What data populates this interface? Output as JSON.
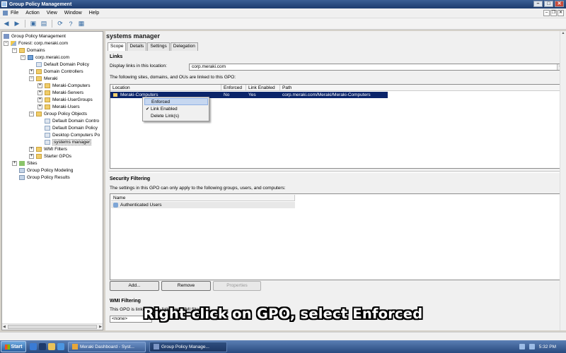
{
  "window": {
    "title": "Group Policy Management"
  },
  "menu": [
    "File",
    "Action",
    "View",
    "Window",
    "Help"
  ],
  "tree": {
    "items": [
      {
        "label": "Group Policy Management",
        "icon": "gpm-icon"
      },
      {
        "label": "Forest: corp.meraki.com",
        "icon": "forest-icon"
      },
      {
        "label": "Domains",
        "icon": "folder-icon"
      },
      {
        "label": "corp.meraki.com",
        "icon": "domain-icon"
      },
      {
        "label": "Default Domain Policy",
        "icon": "gpo-link-icon"
      },
      {
        "label": "Domain Controllers",
        "icon": "ou-icon"
      },
      {
        "label": "Meraki",
        "icon": "ou-icon"
      },
      {
        "label": "Meraki-Computers",
        "icon": "ou-icon"
      },
      {
        "label": "Meraki-Servers",
        "icon": "ou-icon"
      },
      {
        "label": "Meraki-UserGroups",
        "icon": "ou-icon"
      },
      {
        "label": "Meraki-Users",
        "icon": "ou-icon"
      },
      {
        "label": "Group Policy Objects",
        "icon": "folder-icon"
      },
      {
        "label": "Default Domain Contro",
        "icon": "gpo-icon"
      },
      {
        "label": "Default Domain Policy",
        "icon": "gpo-icon"
      },
      {
        "label": "Desktop Computers Po",
        "icon": "gpo-icon"
      },
      {
        "label": "systems manager",
        "icon": "gpo-icon"
      },
      {
        "label": "WMI Filters",
        "icon": "folder-icon"
      },
      {
        "label": "Starter GPOs",
        "icon": "folder-icon"
      },
      {
        "label": "Sites",
        "icon": "sites-icon"
      },
      {
        "label": "Group Policy Modeling",
        "icon": "report-icon"
      },
      {
        "label": "Group Policy Results",
        "icon": "report-icon"
      }
    ]
  },
  "right": {
    "title": "systems manager",
    "tabs": [
      "Scope",
      "Details",
      "Settings",
      "Delegation"
    ],
    "links": {
      "heading": "Links",
      "display_label": "Display links in this location:",
      "location_value": "corp.meraki.com",
      "description": "The following sites, domains, and OUs are linked to this GPO:",
      "columns": [
        "Location",
        "Enforced",
        "Link Enabled",
        "Path"
      ],
      "row": {
        "location": "Meraki-Computers",
        "enforced": "No",
        "link_enabled": "Yes",
        "path": "corp.meraki.com/Meraki/Meraki-Computers"
      }
    },
    "context_menu": {
      "items": [
        "Enforced",
        "Link Enabled",
        "Delete Link(s)"
      ],
      "checked_item": "Link Enabled",
      "hovered_item": "Enforced"
    },
    "security": {
      "heading": "Security Filtering",
      "description": "The settings in this GPO can only apply to the following groups, users, and computers:",
      "column": "Name",
      "entries": [
        "Authenticated Users"
      ]
    },
    "buttons": {
      "add": "Add...",
      "remove": "Remove",
      "properties": "Properties"
    },
    "wmi": {
      "heading": "WMI Filtering",
      "description": "This GPO is linked to the following WMI filter:",
      "value": "<none>"
    }
  },
  "caption": "Right-click on GPO, select Enforced",
  "taskbar": {
    "start_label": "Start",
    "tasks": [
      "Meraki Dashboard - Syst...",
      "Group Policy Manage..."
    ],
    "clock": "5:32 PM"
  }
}
